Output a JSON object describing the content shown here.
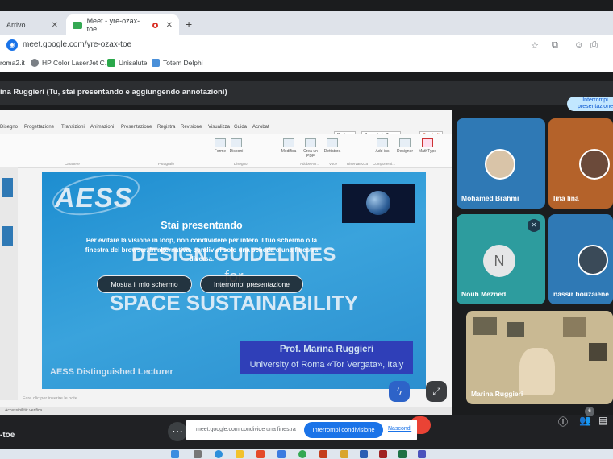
{
  "browser": {
    "tabs": [
      {
        "label": "Arrivo"
      },
      {
        "label": "Meet - yre-ozax-toe"
      }
    ],
    "url": "meet.google.com/yre-ozax-toe",
    "bookmarks": [
      {
        "label": "roma2.it"
      },
      {
        "label": "HP Color LaserJet C..."
      },
      {
        "label": "Unisalute"
      },
      {
        "label": "Totem Delphi"
      }
    ]
  },
  "meet": {
    "presenting_banner": "ina Ruggieri (Tu, stai presentando e aggiungendo annotazioni)",
    "stop_presenting_top": "Interrompi presentazione",
    "overlay": {
      "title": "Stai presentando",
      "message": "Per evitare la visione in loop, non condividere per intero il tuo schermo o la finestra del browser. In alternativa, condividi solo una scheda o una finestra diversa.",
      "show_screen_btn": "Mostra il mio schermo",
      "stop_btn": "Interrompi presentazione"
    },
    "participants": [
      {
        "name": "Mohamed Brahmi"
      },
      {
        "name": "lina lina"
      },
      {
        "name": "Nouh Mezned",
        "initial": "N"
      },
      {
        "name": "nassir bouzaiene"
      },
      {
        "name": "Marina Ruggieri"
      }
    ],
    "meeting_code": "-toe",
    "participant_count": "6",
    "share_toast": {
      "text": "meet.google.com condivide una finestra",
      "stop_btn": "Interrompi condivisione",
      "hide": "Nascondi"
    }
  },
  "ppt": {
    "tabs": [
      "Disegno",
      "Progettazione",
      "Transizioni",
      "Animazioni",
      "Presentazione",
      "Registra",
      "Revisione",
      "Visualizza",
      "Guida",
      "Acrobat"
    ],
    "top_buttons": [
      "Registra",
      "Presenta in Teams",
      "Condividi"
    ],
    "ribbon_buttons": [
      "Forme",
      "Disponi",
      "Modifica",
      "Crea un PDF",
      "Dettatura",
      "Add-ins",
      "Designer",
      "MathType"
    ],
    "groups": [
      "Carattere",
      "Paragrafo",
      "Disegno",
      "Adobe Acr...",
      "Voce",
      "Riservatezza",
      "Componenti..."
    ],
    "notes": "Fare clic per inserire le note",
    "status": "Accessibilità: verifica"
  },
  "slide": {
    "logo": "AESS",
    "title_line1": "DESIGN GUIDELINES",
    "title_line2": "for",
    "title_line3": "SPACE SUSTAINABILITY",
    "presenter": "Prof. Marina Ruggieri",
    "affiliation": "University of Roma «Tor Vergata», Italy",
    "footer": "AESS Distinguished Lecturer"
  }
}
